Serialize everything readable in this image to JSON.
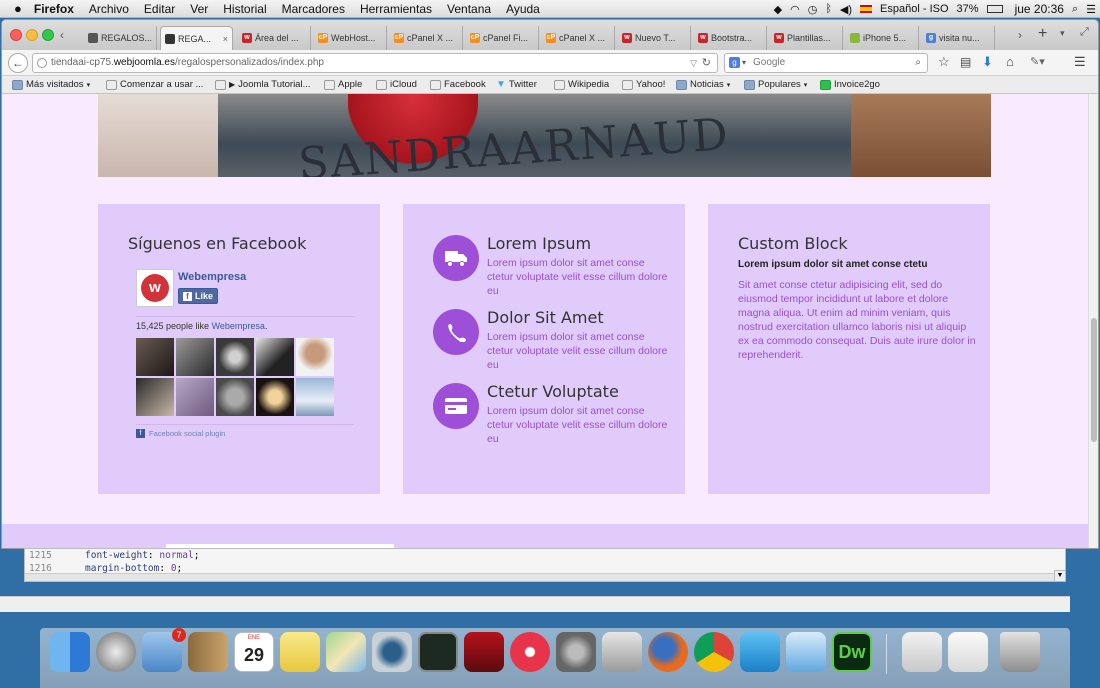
{
  "menubar": {
    "app": "Firefox",
    "items": [
      "Archivo",
      "Editar",
      "Ver",
      "Historial",
      "Marcadores",
      "Herramientas",
      "Ventana",
      "Ayuda"
    ],
    "input_source": "Español - ISO",
    "battery": "37%",
    "clock": "jue 20:36"
  },
  "tabs": [
    {
      "label": "REGALOS..."
    },
    {
      "label": "REGA..."
    },
    {
      "label": "Área del ..."
    },
    {
      "label": "WebHost..."
    },
    {
      "label": "cPanel X ..."
    },
    {
      "label": "cPanel Fi..."
    },
    {
      "label": "cPanel X ..."
    },
    {
      "label": "Nuevo T..."
    },
    {
      "label": "Bootstra..."
    },
    {
      "label": "Plantillas..."
    },
    {
      "label": "iPhone 5..."
    },
    {
      "label": "visita nu..."
    }
  ],
  "address": {
    "prefix": "tiendaai-cp75.",
    "domain": "webjoomla.es",
    "path": "/regalospersonalizados/index.php"
  },
  "search": {
    "placeholder": "Google"
  },
  "bookmarks": [
    "Más visitados",
    "Comenzar a usar ...",
    "Joomla Tutorial...",
    "Apple",
    "iCloud",
    "Facebook",
    "Twitter",
    "Wikipedia",
    "Yahoo!",
    "Noticias",
    "Populares",
    "Invoice2go"
  ],
  "hero": {
    "text": "SANDRAARNAUD"
  },
  "facebook": {
    "title": "Síguenos en Facebook",
    "page_name": "Webempresa",
    "like_button": "Like",
    "people_count": "15,425 people like",
    "people_link": "Webempresa",
    "plugin_label": "Facebook social plugin"
  },
  "features": [
    {
      "title": "Lorem Ipsum",
      "text": "Lorem ipsum dolor sit amet conse ctetur voluptate velit esse cillum dolore eu",
      "icon": "truck-icon"
    },
    {
      "title": "Dolor Sit Amet",
      "text": "Lorem ipsum dolor sit amet conse ctetur voluptate velit esse cillum dolore eu",
      "icon": "phone-icon"
    },
    {
      "title": "Ctetur Voluptate",
      "text": "Lorem ipsum dolor sit amet conse ctetur voluptate velit esse cillum dolore eu",
      "icon": "credit-card-icon"
    }
  ],
  "custom_block": {
    "title": "Custom Block",
    "subtitle": "Lorem ipsum dolor sit amet conse ctetu",
    "text": "Sit amet conse ctetur adipisicing elit, sed do eiusmod tempor incididunt ut labore et dolore magna aliqua. Ut enim ad minim veniam, quis nostrud exercitation ullamco laboris nisi ut aliquip ex ea commodo consequat. Duis aute irure dolor in reprehenderit."
  },
  "editor": {
    "line1_num": "1215",
    "line1_prop": "font-weight",
    "line1_val": "normal",
    "line2_num": "1216",
    "line2_prop": "margin-bottom",
    "line2_val": "0"
  },
  "dock": {
    "calendar_month": "ENE",
    "calendar_day": "29",
    "mail_badge": "7"
  },
  "colors": {
    "accent": "#9d4fd8",
    "panel": "#e1cbfb",
    "page_bg": "#f9eafe"
  }
}
